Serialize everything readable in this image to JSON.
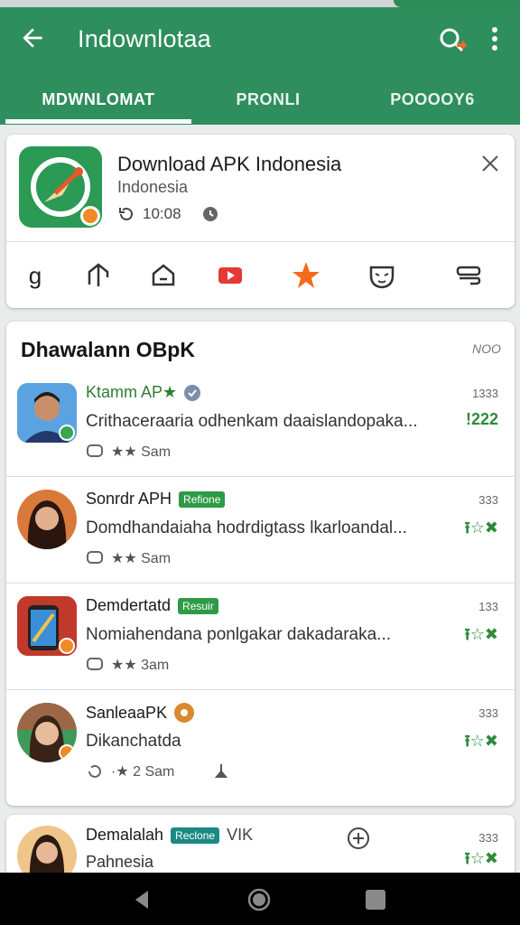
{
  "appbar": {
    "title": "Indownlotaa",
    "icons": [
      "arrow-back-icon",
      "search-icon",
      "more-vert-icon"
    ]
  },
  "tabs": [
    {
      "label": "MDWNLOMAT",
      "active": true
    },
    {
      "label": "PRONLI",
      "active": false
    },
    {
      "label": "POOOOY6",
      "active": false
    }
  ],
  "featured": {
    "title": "Download APK Indonesia",
    "subtitle": "Indonesia",
    "meta_time": "10:08",
    "actions": [
      "g-icon",
      "share-icon",
      "home-icon",
      "youtube-icon",
      "star-icon",
      "mask-icon",
      "storage-icon"
    ],
    "action_first_label": "g"
  },
  "list": {
    "heading": "Dhawalann OBpK",
    "heading_note": "NOO",
    "items": [
      {
        "name": "Ktamm AP★",
        "tag": "",
        "desc": "Crithaceraaria odhenkam daaislandopaka...",
        "stats": "★★ Sam",
        "right_top": "1333",
        "right_mid": "!222"
      },
      {
        "name": "Sonrdr APH",
        "tag": "Refione",
        "desc": "Domdhandaiaha hodrdigtass lkarloandal...",
        "stats": "★★ Sam",
        "right_top": "333",
        "right_mid": "⭱☆✖"
      },
      {
        "name": "Demdertatd",
        "tag": "Resuir",
        "desc": "Nomiahendana ponlgakar dakadaraka...",
        "stats": "★★ 3am",
        "right_top": "133",
        "right_mid": "⭱☆✖"
      },
      {
        "name": "SanleaaPK",
        "tag": "",
        "desc": "Dikanchatda",
        "stats": "·★ 2 Sam",
        "right_top": "333",
        "right_mid": "⭱☆✖"
      }
    ]
  },
  "partial": {
    "name": "Demalalah",
    "tag": "Reclone",
    "tag_suffix": "VIK",
    "desc": "Pahnesia",
    "right_top": "333",
    "right_mid": "⭱☆✖"
  },
  "colors": {
    "primary": "#2e8e5e",
    "accent_orange": "#f08a24",
    "tag_green": "#2e9a46",
    "tag_teal": "#1c8a83"
  }
}
